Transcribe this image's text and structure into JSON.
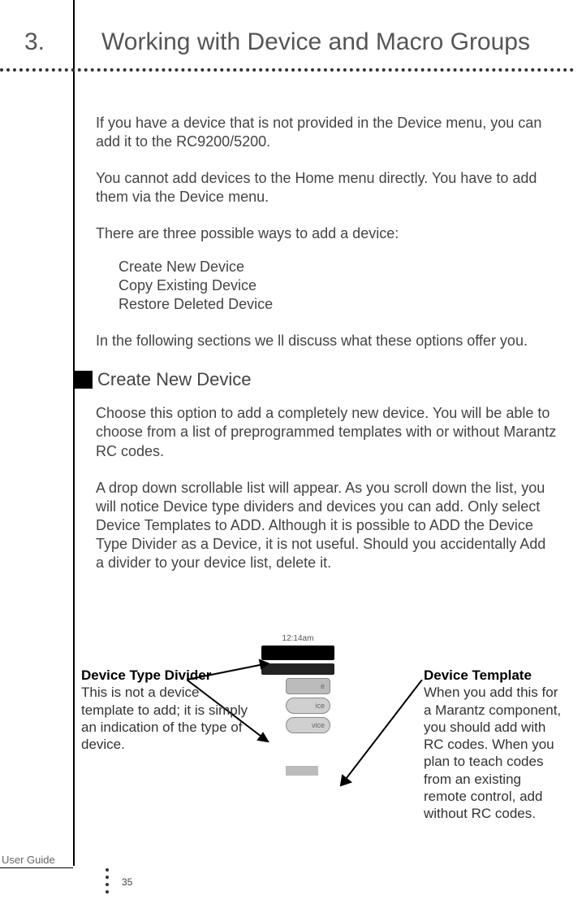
{
  "chapter": {
    "number": "3.",
    "title": "Working with Device and Macro Groups"
  },
  "body": {
    "para1": "If you have a device that is not provided in the Device menu, you can add it to the RC9200/5200.",
    "para2": "You cannot add devices to the Home menu directly. You have to add them via the Device menu.",
    "para3": "There are three possible ways to add a device:",
    "options": {
      "o1": "Create New Device",
      "o2": "Copy Existing Device",
      "o3": "Restore Deleted Device"
    },
    "para4": "In the following sections we ll discuss what these options offer you.",
    "section_head": "Create New Device",
    "para5": "Choose this option to add a completely new device. You will be able to choose from a list of preprogrammed templates with or without Marantz RC codes.",
    "para6": "A drop down scrollable list will appear. As you scroll down the list, you will notice Device type dividers and devices you can add. Only select Device Templates to ADD. Although it is possible to ADD the Device Type Divider as a Device, it is not useful. Should you accidentally Add a divider to your device list, delete it."
  },
  "device_image": {
    "time": "12:14am",
    "item1": "e",
    "item2": "ice",
    "item3": "vice"
  },
  "callouts": {
    "left_title": "Device Type Divider",
    "left_body": "This is not a device template to add; it is simply an indication of the type of device.",
    "right_title": "Device Template",
    "right_body": "When you add this for a Marantz component, you should add with RC codes. When you plan to teach codes from an existing remote control, add without RC codes."
  },
  "footer": {
    "label": "User Guide",
    "page": "35"
  }
}
